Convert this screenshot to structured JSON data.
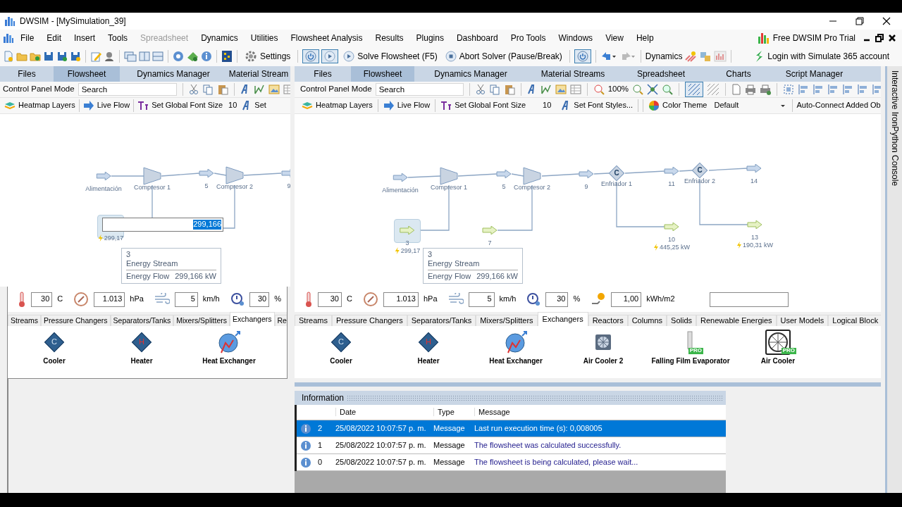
{
  "window": {
    "title": "DWSIM - [MySimulation_39]"
  },
  "menu": [
    {
      "label": "File",
      "disabled": false
    },
    {
      "label": "Edit",
      "disabled": false
    },
    {
      "label": "Insert",
      "disabled": false
    },
    {
      "label": "Tools",
      "disabled": false
    },
    {
      "label": "Spreadsheet",
      "disabled": true
    },
    {
      "label": "Dynamics",
      "disabled": false
    },
    {
      "label": "Utilities",
      "disabled": false
    },
    {
      "label": "Flowsheet Analysis",
      "disabled": false
    },
    {
      "label": "Results",
      "disabled": false
    },
    {
      "label": "Plugins",
      "disabled": false
    },
    {
      "label": "Dashboard",
      "disabled": false
    },
    {
      "label": "Pro Tools",
      "disabled": false
    },
    {
      "label": "Windows",
      "disabled": false
    },
    {
      "label": "View",
      "disabled": false
    },
    {
      "label": "Help",
      "disabled": false
    }
  ],
  "pro_trial": "Free DWSIM Pro Trial",
  "toolbar": {
    "settings": "Settings",
    "solve": "Solve Flowsheet (F5)",
    "abort": "Abort Solver (Pause/Break)",
    "dynamics": "Dynamics",
    "login": "Login with Simulate 365 account",
    "toggles": [
      {
        "on": true
      },
      {
        "on": true
      },
      {
        "on": true
      }
    ]
  },
  "panels": [
    {
      "tabs": [
        {
          "label": "Files",
          "selected": false
        },
        {
          "label": "Flowsheet",
          "selected": true
        },
        {
          "label": "Dynamics Manager",
          "selected": false
        },
        {
          "label": "Material Stream",
          "selected": false
        }
      ],
      "control_panel_mode": "Control Panel Mode",
      "search": {
        "placeholder": "Search"
      },
      "view_tools": [
        {
          "kind": "layers",
          "label": "Heatmap Layers"
        },
        {
          "kind": "flow",
          "label": "Live Flow"
        },
        {
          "kind": "font_size",
          "label": "Set Global Font Size"
        },
        {
          "kind": "number",
          "label": "10"
        },
        {
          "kind": "font_style",
          "label": "Set"
        }
      ],
      "canvas": {
        "objects": [
          {
            "kind": "material",
            "label": "Alimentación"
          },
          {
            "kind": "compressor",
            "label": "Compresor 1"
          },
          {
            "kind": "material",
            "label": "5"
          },
          {
            "kind": "compressor",
            "label": "Compresor 2"
          },
          {
            "kind": "material",
            "label": "9"
          },
          {
            "kind": "energy",
            "selected": true,
            "reading": "299,17"
          }
        ],
        "editor": {
          "value": "299,166"
        },
        "tooltip": {
          "title": "3",
          "subtitle": "Energy Stream",
          "property": "Energy Flow",
          "value": "299,166 kW"
        }
      },
      "weather": [
        {
          "kind": "temperature",
          "value": "30",
          "unit": "C"
        },
        {
          "kind": "pressure",
          "value": "1.013",
          "unit": "hPa"
        },
        {
          "kind": "wind",
          "value": "5",
          "unit": "km/h"
        },
        {
          "kind": "humidity",
          "value": "30",
          "unit": "%"
        }
      ],
      "palette": {
        "tabs": [
          {
            "label": "Streams",
            "selected": false
          },
          {
            "label": "Pressure Changers",
            "selected": false
          },
          {
            "label": "Separators/Tanks",
            "selected": false
          },
          {
            "label": "Mixers/Splitters",
            "selected": false
          },
          {
            "label": "Exchangers",
            "selected": true
          },
          {
            "label": "Re",
            "selected": false
          }
        ],
        "items": [
          {
            "kind": "cooler",
            "symbol": "C",
            "label": "Cooler"
          },
          {
            "kind": "heater",
            "symbol": "H",
            "label": "Heater"
          },
          {
            "kind": "heat_exchanger",
            "label": "Heat Exchanger"
          }
        ]
      }
    },
    {
      "tabs": [
        {
          "label": "Files",
          "selected": false
        },
        {
          "label": "Flowsheet",
          "selected": true
        },
        {
          "label": "Dynamics Manager",
          "selected": false
        },
        {
          "label": "Material Streams",
          "selected": false
        },
        {
          "label": "Spreadsheet",
          "selected": false
        },
        {
          "label": "Charts",
          "selected": false
        },
        {
          "label": "Script Manager",
          "selected": false
        }
      ],
      "control_panel_mode": "Control Panel Mode",
      "search": {
        "placeholder": "Search"
      },
      "zoom_level": "100%",
      "grid_on": true,
      "view_tools": [
        {
          "kind": "layers",
          "label": "Heatmap Layers"
        },
        {
          "kind": "flow",
          "label": "Live Flow"
        },
        {
          "kind": "font_size",
          "label": "Set Global Font Size"
        },
        {
          "kind": "number",
          "label": "10"
        },
        {
          "kind": "font_style",
          "label": "Set Font Styles..."
        },
        {
          "kind": "color_theme",
          "label": "Color Theme"
        },
        {
          "kind": "dropdown",
          "label": "Default"
        },
        {
          "kind": "text",
          "label": "Auto-Connect Added Ob"
        }
      ],
      "canvas": {
        "objects": [
          {
            "kind": "material",
            "label": "Alimentación"
          },
          {
            "kind": "compressor",
            "label": "Compresor 1"
          },
          {
            "kind": "material",
            "label": "5"
          },
          {
            "kind": "compressor",
            "label": "Compresor 2"
          },
          {
            "kind": "material",
            "label": "9"
          },
          {
            "kind": "cooler",
            "symbol": "C",
            "label": "Enfriador 1"
          },
          {
            "kind": "material",
            "label": "11"
          },
          {
            "kind": "cooler",
            "symbol": "C",
            "label": "Enfriador 2"
          },
          {
            "kind": "material",
            "label": "14"
          },
          {
            "kind": "energy",
            "label": "3",
            "selected": true,
            "reading": "299,17"
          },
          {
            "kind": "energy",
            "label": "7",
            "selected": false
          },
          {
            "kind": "energy",
            "label": "10",
            "selected": false,
            "reading": "445,25 kW"
          },
          {
            "kind": "energy",
            "label": "13",
            "selected": false,
            "reading": "190,31 kW"
          }
        ],
        "tooltip": {
          "title": "3",
          "subtitle": "Energy Stream",
          "property": "Energy Flow",
          "value": "299,166 kW"
        }
      },
      "weather": [
        {
          "kind": "temperature",
          "value": "30",
          "unit": "C"
        },
        {
          "kind": "pressure",
          "value": "1.013",
          "unit": "hPa"
        },
        {
          "kind": "wind",
          "value": "5",
          "unit": "km/h"
        },
        {
          "kind": "humidity",
          "value": "30",
          "unit": "%"
        },
        {
          "kind": "solar",
          "value": "1,00",
          "unit": "kWh/m2"
        },
        {
          "kind": "field"
        }
      ],
      "palette": {
        "tabs": [
          {
            "label": "Streams",
            "selected": false
          },
          {
            "label": "Pressure Changers",
            "selected": false
          },
          {
            "label": "Separators/Tanks",
            "selected": false
          },
          {
            "label": "Mixers/Splitters",
            "selected": false
          },
          {
            "label": "Exchangers",
            "selected": true
          },
          {
            "label": "Reactors",
            "selected": false
          },
          {
            "label": "Columns",
            "selected": false
          },
          {
            "label": "Solids",
            "selected": false
          },
          {
            "label": "Renewable Energies",
            "selected": false
          },
          {
            "label": "User Models",
            "selected": false
          },
          {
            "label": "Logical Block",
            "selected": false
          }
        ],
        "items": [
          {
            "kind": "cooler",
            "symbol": "C",
            "label": "Cooler"
          },
          {
            "kind": "heater",
            "symbol": "H",
            "label": "Heater"
          },
          {
            "kind": "heat_exchanger",
            "label": "Heat Exchanger"
          },
          {
            "kind": "air_cooler_2",
            "label": "Air Cooler 2"
          },
          {
            "kind": "evaporator",
            "badge": "PRO",
            "label": "Falling Film Evaporator"
          },
          {
            "kind": "air_cooler",
            "badge": "PRO",
            "label": "Air Cooler"
          }
        ]
      },
      "information": {
        "title": "Information",
        "columns": [
          "Date",
          "Type",
          "Message"
        ],
        "rows": [
          {
            "selected": true,
            "number": "2",
            "date": "25/08/2022 10:07:57 p. m.",
            "type": "Message",
            "message": "Last run execution time (s): 0,008005"
          },
          {
            "selected": false,
            "number": "1",
            "date": "25/08/2022 10:07:57 p. m.",
            "type": "Message",
            "message": "The flowsheet was calculated successfully."
          },
          {
            "selected": false,
            "number": "0",
            "date": "25/08/2022 10:07:57 p. m.",
            "type": "Message",
            "message": "The flowsheet is being calculated, please wait..."
          }
        ]
      }
    }
  ],
  "console_tab": "Interactive IronPython Console"
}
